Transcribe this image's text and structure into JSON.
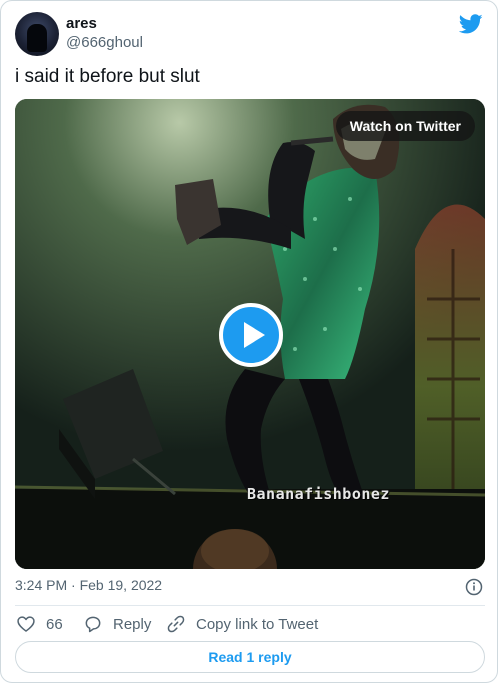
{
  "author": {
    "display_name": "ares",
    "handle": "@666ghoul"
  },
  "tweet": {
    "text": "i said it before but slut"
  },
  "media": {
    "watch_label": "Watch on Twitter",
    "watermark": "Bananafishbonez",
    "play_icon": "play-icon"
  },
  "meta": {
    "timestamp": "3:24 PM · Feb 19, 2022"
  },
  "actions": {
    "like_count": "66",
    "reply_label": "Reply",
    "copy_label": "Copy link to Tweet"
  },
  "replies": {
    "read_label": "Read 1 reply"
  },
  "colors": {
    "brand": "#1d9bf0",
    "secondary_text": "#536471"
  }
}
